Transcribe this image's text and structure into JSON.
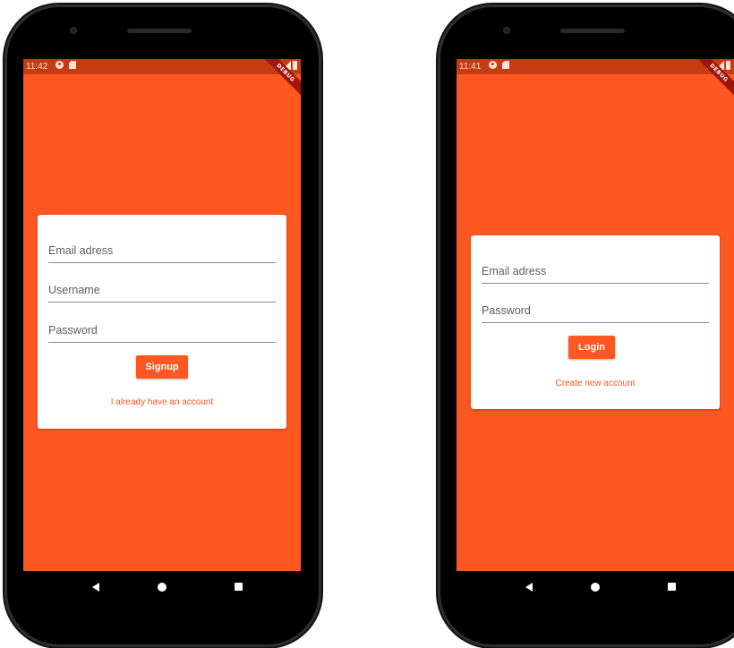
{
  "signup_screen": {
    "status": {
      "time": "11:42"
    },
    "debug_banner": "DEBUG",
    "form": {
      "email_placeholder": "Email adress",
      "username_placeholder": "Username",
      "password_placeholder": "Password",
      "submit_label": "Signup",
      "switch_link": "I already have an account"
    }
  },
  "login_screen": {
    "status": {
      "time": "11:41"
    },
    "debug_banner": "DEBUG",
    "form": {
      "email_placeholder": "Email adress",
      "password_placeholder": "Password",
      "submit_label": "Login",
      "switch_link": "Create new account"
    }
  },
  "icons": [
    "sync-icon",
    "sd-card-icon",
    "wifi-icon",
    "signal-icon",
    "battery-icon",
    "back-icon",
    "home-icon",
    "recents-icon"
  ],
  "colors": {
    "primary": "#fe5722",
    "status_bar": "#c33d11",
    "card": "#ffffff",
    "phone_frame": "#000000"
  }
}
